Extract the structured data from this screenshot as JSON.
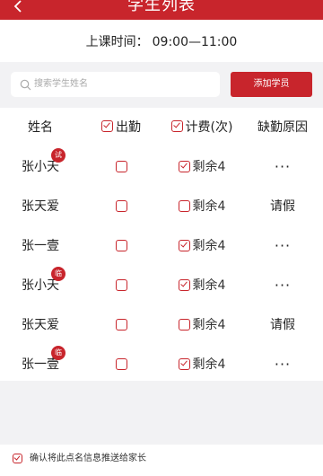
{
  "header": {
    "title": "学生列表"
  },
  "schedule": {
    "label": "上课时间：",
    "time": "09:00—11:00"
  },
  "search": {
    "placeholder": "搜索学生姓名",
    "add_button": "添加学员"
  },
  "columns": {
    "name": "姓名",
    "attendance": "出勤",
    "fee": "计费(次)",
    "reason": "缺勤原因"
  },
  "rows": [
    {
      "name": "张小天",
      "badge": "试",
      "attendance": false,
      "fee_checked": true,
      "fee": "剩余4",
      "reason": "···"
    },
    {
      "name": "张天爱",
      "badge": "",
      "attendance": false,
      "fee_checked": false,
      "fee": "剩余4",
      "reason": "请假"
    },
    {
      "name": "张一壹",
      "badge": "",
      "attendance": false,
      "fee_checked": true,
      "fee": "剩余4",
      "reason": "···"
    },
    {
      "name": "张小天",
      "badge": "临",
      "attendance": false,
      "fee_checked": true,
      "fee": "剩余4",
      "reason": "···"
    },
    {
      "name": "张天爱",
      "badge": "",
      "attendance": false,
      "fee_checked": false,
      "fee": "剩余4",
      "reason": "请假"
    },
    {
      "name": "张一壹",
      "badge": "临",
      "attendance": false,
      "fee_checked": true,
      "fee": "剩余4",
      "reason": "···"
    }
  ],
  "footer": {
    "checked": true,
    "text": "确认将此点名信息推送给家长"
  },
  "colors": {
    "accent": "#c8252c",
    "background": "#f2f2f4"
  },
  "icons": {
    "back": "chevron-left-icon",
    "search": "search-icon"
  }
}
